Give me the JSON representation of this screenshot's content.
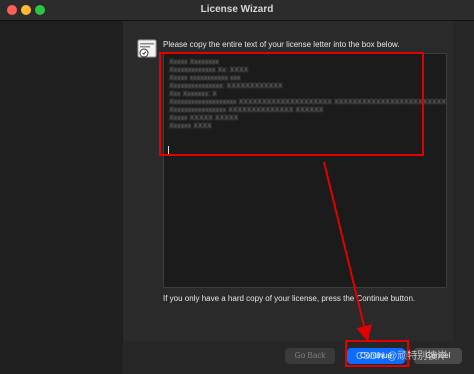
{
  "window": {
    "title": "License Wizard"
  },
  "dialog": {
    "instruction": "Please copy the entire text of your license letter into the box below.",
    "license_text_lines": [
      "Xxxxx Xxxxxxxx",
      "Xxxxxxxxxxxxx Xx: XXXX",
      "Xxxxx xxxxxxxxxxx xxx",
      "Xxxxxxxxxxxxxxx: XXXXXXXXXXXX",
      "Xxx Xxxxxxx: X",
      "Xxxxxxxxxxxxxxxxxxx XXXXXXXXXXXXXXXXXXXX XXXXXXXXXXXXXXXXXXXXXXXX",
      "Xxxxxxxxxxxxxxxx XXXXXXXXXXXXXX XXXXXX",
      "Xxxxx XXXXX XXXXX",
      "Xxxxxx XXXX"
    ],
    "footer_note": "If you only have a hard copy of your license, press the Continue button."
  },
  "buttons": {
    "back": "Go Back",
    "continue": "Continue",
    "cancel": "Cancel"
  },
  "watermark": "CSDN @顽特别彼岸",
  "icons": {
    "doc": "license-document-icon"
  },
  "colors": {
    "accent": "#0b6dff",
    "annotation": "#e00000"
  }
}
